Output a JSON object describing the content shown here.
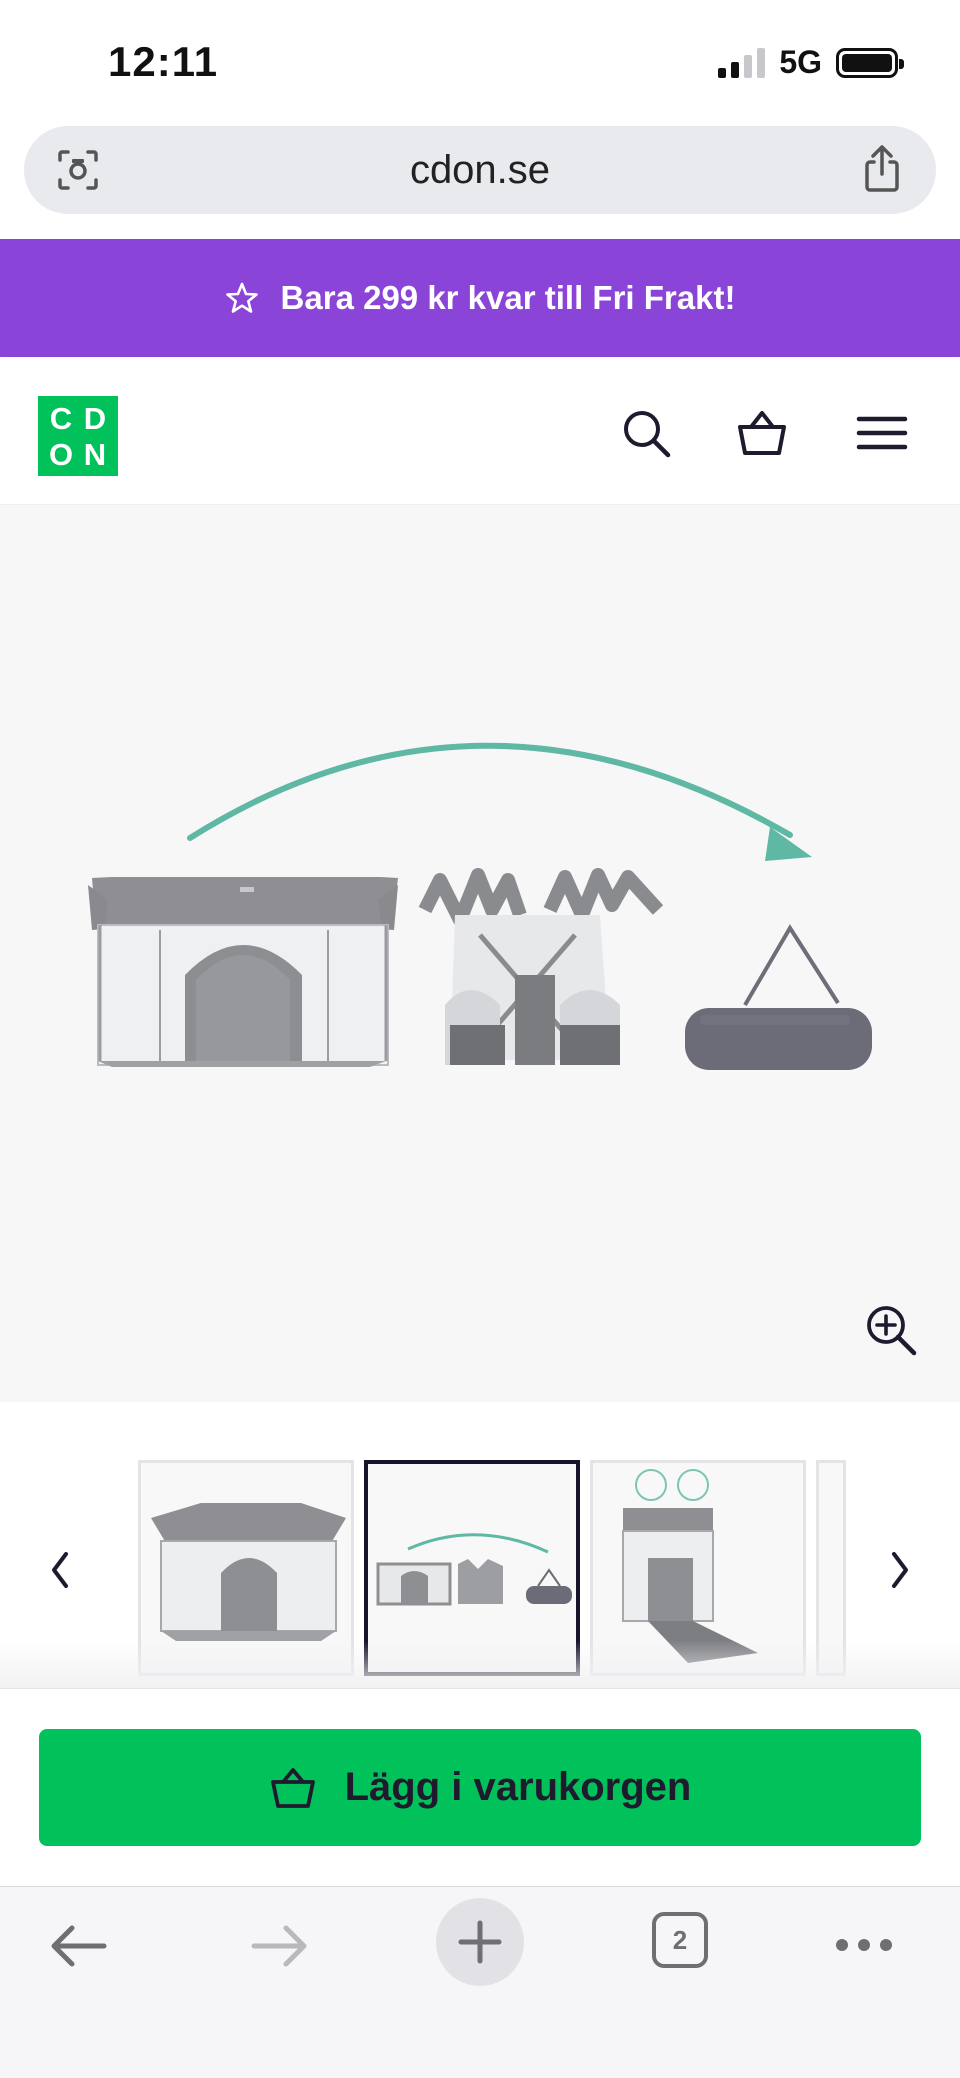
{
  "status_bar": {
    "time": "12:11",
    "network": "5G"
  },
  "browser": {
    "url": "cdon.se",
    "tab_count": "2"
  },
  "promo": {
    "text": "Bara 299 kr kvar till Fri Frakt!",
    "icon": "star-icon"
  },
  "header": {
    "logo_letters": [
      "C",
      "D",
      "O",
      "N"
    ],
    "icons": [
      "search-icon",
      "basket-icon",
      "menu-icon"
    ]
  },
  "gallery": {
    "selected_index": 1,
    "thumbnail_count": 4,
    "icons": [
      "zoom-in-icon",
      "chevron-left-icon",
      "chevron-right-icon"
    ]
  },
  "cta": {
    "label": "Lägg i varukorgen",
    "icon": "basket-icon"
  },
  "colors": {
    "brand_green": "#00c15a",
    "promo_purple": "#8b44d8",
    "arrow_teal": "#5fb8a4",
    "text_dark": "#1f1a2e"
  }
}
